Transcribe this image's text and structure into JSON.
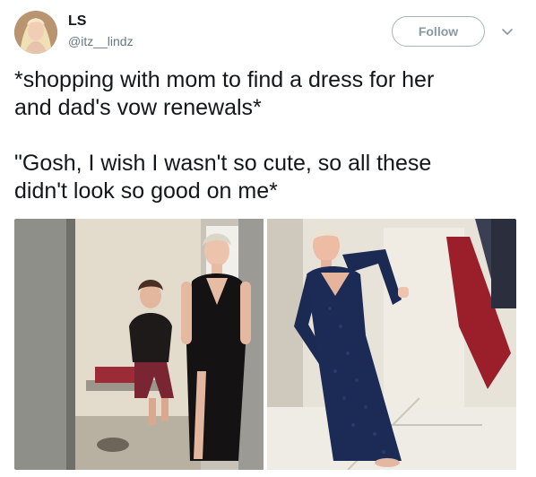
{
  "tweet": {
    "author": {
      "display_name": "LS",
      "handle": "@itz__lindz",
      "avatar_icon": "profile-photo"
    },
    "follow_label": "Follow",
    "menu_icon": "chevron-down-icon",
    "text_lines": [
      "*shopping with mom to find a dress for her",
      "and dad's vow renewals*",
      "",
      "\"Gosh, I wish I wasn't so cute, so all these",
      "didn't look so good on me*"
    ],
    "media": [
      {
        "alt": "mirror selfie in a black dress in a fitting room"
      },
      {
        "alt": "mirror photo in a navy lace dress in a fitting room"
      }
    ]
  },
  "colors": {
    "text": "#14171a",
    "secondary": "#657786",
    "follow_border": "#a6b4bf",
    "follow_text": "#8899a6"
  }
}
